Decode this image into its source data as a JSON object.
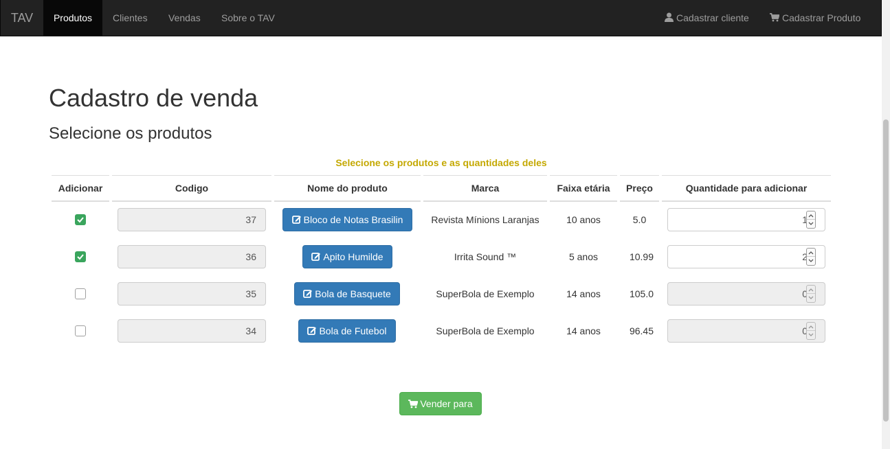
{
  "navbar": {
    "brand": "TAV",
    "items": [
      {
        "label": "Produtos",
        "active": true
      },
      {
        "label": "Clientes"
      },
      {
        "label": "Vendas"
      },
      {
        "label": "Sobre o TAV"
      }
    ],
    "right": [
      {
        "label": "Cadastrar cliente",
        "icon": "user-icon"
      },
      {
        "label": "Cadastrar Produto",
        "icon": "cart-icon"
      }
    ]
  },
  "page": {
    "title": "Cadastro de venda",
    "subtitle": "Selecione os produtos"
  },
  "table": {
    "caption": "Selecione os produtos e as quantidades deles",
    "headers": [
      "Adicionar",
      "Codigo",
      "Nome do produto",
      "Marca",
      "Faixa etária",
      "Preço",
      "Quantidade para adicionar"
    ],
    "rows": [
      {
        "checked": true,
        "codigo": "37",
        "nome": "Bloco de Notas Brasilin",
        "marca": "Revista Mínions Laranjas",
        "faixa": "10 anos",
        "preco": "5.0",
        "quantidade": "1"
      },
      {
        "checked": true,
        "codigo": "36",
        "nome": "Apito Humilde",
        "marca": "Irrita Sound ™",
        "faixa": "5 anos",
        "preco": "10.99",
        "quantidade": "2"
      },
      {
        "checked": false,
        "codigo": "35",
        "nome": "Bola de Basquete",
        "marca": "SuperBola de Exemplo",
        "faixa": "14 anos",
        "preco": "105.0",
        "quantidade": "0"
      },
      {
        "checked": false,
        "codigo": "34",
        "nome": "Bola de Futebol",
        "marca": "SuperBola de Exemplo",
        "faixa": "14 anos",
        "preco": "96.45",
        "quantidade": "0"
      }
    ]
  },
  "actions": {
    "sell_label": "Vender para"
  },
  "colors": {
    "navbar": "#222222",
    "primary": "#337ab7",
    "success": "#5cb85c",
    "caption": "#c4a800"
  }
}
